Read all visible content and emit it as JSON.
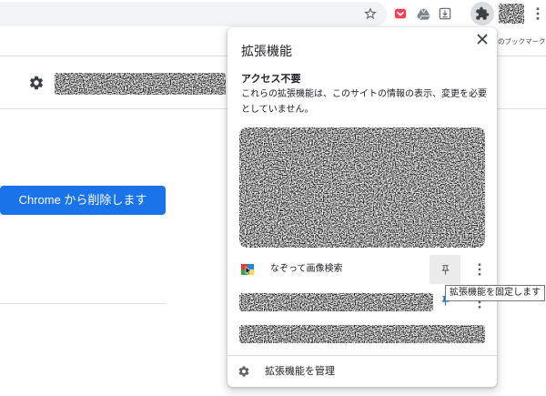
{
  "colors": {
    "accent": "#1a73e8",
    "pocket_brand": "#ef4056",
    "toolbar_button_active_bg": "#dadce0"
  },
  "toolbar": {
    "omnibox_icons": [
      "star-icon"
    ],
    "extension_icons": [
      "pocket-icon",
      "drive-icon",
      "download-box-icon"
    ],
    "buttons": [
      "puzzle-icon",
      "avatar",
      "kebab-menu-icon"
    ],
    "extensions_button_active": true
  },
  "bookmarks_bar": {
    "other_bookmarks_label": "のブックマーク"
  },
  "page": {
    "remove_button_label": "Chrome から削除します"
  },
  "extensions_popup": {
    "title": "拡張機能",
    "section_heading": "アクセス不要",
    "section_description": [
      "これらの拡張機能は、このサイトの情報の表示、変更を必要",
      "としていません。"
    ],
    "items": [
      {
        "name": "なぞって画像検索",
        "pinned": false,
        "icon": "image-search-extension-icon"
      },
      {
        "pinned": true
      }
    ],
    "pin_tooltip": "拡張機能を固定します",
    "manage_label": "拡張機能を管理",
    "icons": {
      "close": "close-icon",
      "pin": "pin-icon",
      "more": "kebab-menu-icon",
      "manage": "gear-icon"
    }
  }
}
